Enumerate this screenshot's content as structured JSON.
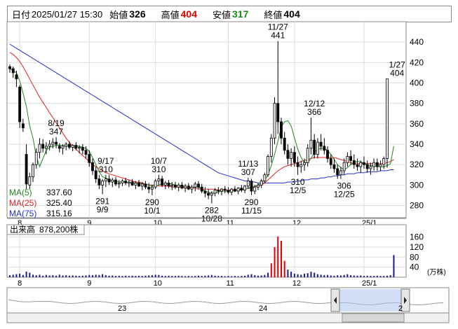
{
  "header": {
    "date_label": "日付",
    "datetime": "2025/01/27 15:30",
    "open_label": "始値",
    "open": "326",
    "high_label": "高値",
    "high": "404",
    "low_label": "安値",
    "low": "317",
    "close_label": "終値",
    "close": "404"
  },
  "colors": {
    "up": "#0a0a0a",
    "down": "#f2f2f2",
    "ma5": "#1a8a1a",
    "ma25": "#e02020",
    "ma75": "#2030d0",
    "vol": "#1a1a8a",
    "vol_hi": "#e00000",
    "high_text": "#e00000",
    "low_text": "#1a8a1a"
  },
  "chart_data": [
    {
      "type": "candlestick",
      "y_axis_ticks": [
        280,
        300,
        320,
        340,
        360,
        380,
        400,
        420,
        440
      ],
      "ylim": [
        268,
        460
      ],
      "x_month_labels": [
        {
          "i": 3,
          "label": "8"
        },
        {
          "i": 24,
          "label": "9"
        },
        {
          "i": 44,
          "label": "10"
        },
        {
          "i": 66,
          "label": "11"
        },
        {
          "i": 86,
          "label": "12"
        },
        {
          "i": 107,
          "label": "25/1"
        }
      ],
      "legend": [
        {
          "name": "MA(5)",
          "value": "337.60",
          "color": "#1a8a1a"
        },
        {
          "name": "MA(25)",
          "value": "325.40",
          "color": "#e02020"
        },
        {
          "name": "MA(75)",
          "value": "315.16",
          "color": "#2030d0"
        }
      ],
      "annotations": [
        {
          "i": 14,
          "y": 347,
          "text": [
            "8/19",
            "347"
          ],
          "pos": "above"
        },
        {
          "i": 29,
          "y": 310,
          "text": [
            "9/17",
            "310"
          ],
          "pos": "above"
        },
        {
          "i": 28,
          "y": 291,
          "text": [
            "291",
            "9/9"
          ],
          "pos": "below"
        },
        {
          "i": 45,
          "y": 310,
          "text": [
            "10/7",
            "310"
          ],
          "pos": "above"
        },
        {
          "i": 43,
          "y": 290,
          "text": [
            "290",
            "10/1"
          ],
          "pos": "below"
        },
        {
          "i": 61,
          "y": 282,
          "text": [
            "282",
            "10/28"
          ],
          "pos": "below"
        },
        {
          "i": 72,
          "y": 307,
          "text": [
            "11/13",
            "307"
          ],
          "pos": "above"
        },
        {
          "i": 73,
          "y": 290,
          "text": [
            "290",
            "11/15",
            ""
          ],
          "pos": "below"
        },
        {
          "i": 81,
          "y": 441,
          "text": [
            "11/27",
            "441"
          ],
          "pos": "above"
        },
        {
          "i": 87,
          "y": 310,
          "text": [
            "310",
            "12/5"
          ],
          "pos": "below"
        },
        {
          "i": 92,
          "y": 366,
          "text": [
            "12/12",
            "366"
          ],
          "pos": "above"
        },
        {
          "i": 101,
          "y": 306,
          "text": [
            "306",
            "12/25"
          ],
          "pos": "below"
        },
        {
          "i": 117,
          "y": 404,
          "text": [
            "1/27",
            "404"
          ],
          "pos": "above"
        }
      ],
      "ohlc": [
        [
          416,
          418,
          410,
          414
        ],
        [
          414,
          416,
          405,
          410
        ],
        [
          408,
          412,
          396,
          404
        ],
        [
          396,
          398,
          356,
          362
        ],
        [
          360,
          365,
          352,
          356
        ],
        [
          330,
          340,
          296,
          301
        ],
        [
          300,
          312,
          296,
          308
        ],
        [
          308,
          322,
          303,
          320
        ],
        [
          320,
          336,
          316,
          332
        ],
        [
          332,
          346,
          326,
          340
        ],
        [
          340,
          345,
          332,
          336
        ],
        [
          336,
          342,
          330,
          338
        ],
        [
          338,
          344,
          334,
          340
        ],
        [
          340,
          346,
          336,
          342
        ],
        [
          342,
          347,
          336,
          340
        ],
        [
          338,
          341,
          332,
          336
        ],
        [
          336,
          340,
          330,
          338
        ],
        [
          338,
          342,
          334,
          340
        ],
        [
          340,
          343,
          335,
          337
        ],
        [
          337,
          340,
          333,
          339
        ],
        [
          339,
          342,
          334,
          336
        ],
        [
          336,
          339,
          331,
          337
        ],
        [
          337,
          340,
          330,
          334
        ],
        [
          334,
          338,
          326,
          330
        ],
        [
          330,
          334,
          318,
          322
        ],
        [
          322,
          326,
          310,
          314
        ],
        [
          314,
          318,
          302,
          306
        ],
        [
          306,
          310,
          296,
          300
        ],
        [
          300,
          306,
          291,
          304
        ],
        [
          304,
          310,
          298,
          306
        ],
        [
          306,
          310,
          300,
          303
        ],
        [
          303,
          307,
          298,
          305
        ],
        [
          305,
          308,
          299,
          301
        ],
        [
          301,
          305,
          297,
          302
        ],
        [
          302,
          306,
          299,
          304
        ],
        [
          304,
          307,
          300,
          302
        ],
        [
          302,
          305,
          298,
          303
        ],
        [
          303,
          306,
          299,
          300
        ],
        [
          300,
          304,
          296,
          302
        ],
        [
          302,
          305,
          298,
          299
        ],
        [
          299,
          303,
          295,
          301
        ],
        [
          301,
          304,
          296,
          298
        ],
        [
          298,
          302,
          292,
          296
        ],
        [
          296,
          300,
          290,
          298
        ],
        [
          298,
          306,
          296,
          304
        ],
        [
          304,
          310,
          300,
          306
        ],
        [
          306,
          309,
          298,
          300
        ],
        [
          300,
          304,
          296,
          302
        ],
        [
          302,
          305,
          297,
          299
        ],
        [
          299,
          303,
          295,
          300
        ],
        [
          300,
          303,
          296,
          298
        ],
        [
          298,
          302,
          294,
          300
        ],
        [
          300,
          303,
          296,
          297
        ],
        [
          297,
          301,
          293,
          299
        ],
        [
          299,
          302,
          295,
          296
        ],
        [
          296,
          300,
          292,
          298
        ],
        [
          298,
          303,
          294,
          301
        ],
        [
          301,
          304,
          296,
          298
        ],
        [
          298,
          301,
          292,
          294
        ],
        [
          294,
          298,
          288,
          292
        ],
        [
          292,
          296,
          286,
          290
        ],
        [
          290,
          294,
          282,
          292
        ],
        [
          292,
          297,
          289,
          295
        ],
        [
          295,
          298,
          291,
          294
        ],
        [
          294,
          297,
          290,
          296
        ],
        [
          296,
          299,
          292,
          295
        ],
        [
          295,
          298,
          291,
          293
        ],
        [
          293,
          297,
          290,
          296
        ],
        [
          296,
          299,
          293,
          294
        ],
        [
          294,
          298,
          291,
          297
        ],
        [
          297,
          300,
          293,
          295
        ],
        [
          295,
          300,
          292,
          299
        ],
        [
          299,
          307,
          296,
          304
        ],
        [
          304,
          306,
          290,
          294
        ],
        [
          294,
          300,
          291,
          298
        ],
        [
          298,
          302,
          295,
          300
        ],
        [
          300,
          306,
          297,
          304
        ],
        [
          304,
          312,
          302,
          310
        ],
        [
          310,
          330,
          308,
          328
        ],
        [
          328,
          350,
          322,
          346
        ],
        [
          346,
          386,
          340,
          380
        ],
        [
          380,
          441,
          350,
          362
        ],
        [
          362,
          366,
          340,
          346
        ],
        [
          346,
          352,
          330,
          334
        ],
        [
          334,
          340,
          320,
          326
        ],
        [
          326,
          336,
          318,
          332
        ],
        [
          332,
          338,
          318,
          322
        ],
        [
          322,
          328,
          310,
          318
        ],
        [
          318,
          324,
          312,
          320
        ],
        [
          320,
          326,
          314,
          322
        ],
        [
          322,
          340,
          318,
          336
        ],
        [
          336,
          366,
          330,
          344
        ],
        [
          344,
          350,
          326,
          330
        ],
        [
          330,
          346,
          326,
          342
        ],
        [
          342,
          350,
          334,
          338
        ],
        [
          338,
          346,
          330,
          334
        ],
        [
          334,
          338,
          322,
          326
        ],
        [
          326,
          330,
          316,
          320
        ],
        [
          320,
          326,
          312,
          316
        ],
        [
          316,
          320,
          306,
          310
        ],
        [
          310,
          318,
          306,
          314
        ],
        [
          314,
          326,
          310,
          322
        ],
        [
          322,
          332,
          318,
          328
        ],
        [
          328,
          334,
          320,
          324
        ],
        [
          324,
          330,
          316,
          320
        ],
        [
          320,
          326,
          314,
          318
        ],
        [
          318,
          324,
          312,
          322
        ],
        [
          322,
          328,
          316,
          320
        ],
        [
          320,
          324,
          312,
          316
        ],
        [
          316,
          322,
          310,
          318
        ],
        [
          318,
          326,
          314,
          322
        ],
        [
          322,
          326,
          314,
          318
        ],
        [
          318,
          324,
          314,
          320
        ],
        [
          320,
          328,
          316,
          326
        ],
        [
          326,
          404,
          317,
          404
        ]
      ],
      "ma5": [
        414,
        412,
        410,
        402,
        390,
        377,
        358,
        346,
        328,
        318,
        326,
        334,
        337,
        338,
        339,
        339,
        339,
        338,
        338,
        338,
        338,
        338,
        337,
        336,
        333,
        327,
        320,
        313,
        308,
        307,
        305,
        304,
        304,
        303,
        303,
        303,
        302,
        302,
        302,
        302,
        301,
        301,
        300,
        299,
        299,
        300,
        301,
        301,
        302,
        301,
        300,
        299,
        299,
        298,
        298,
        298,
        298,
        298,
        296,
        294,
        293,
        292,
        292,
        293,
        294,
        294,
        294,
        294,
        295,
        295,
        295,
        296,
        297,
        298,
        299,
        300,
        302,
        305,
        310,
        319,
        330,
        343,
        357,
        362,
        363,
        358,
        346,
        335,
        327,
        322,
        322,
        326,
        332,
        335,
        336,
        336,
        334,
        330,
        325,
        320,
        317,
        315,
        317,
        320,
        322,
        323,
        323,
        321,
        320,
        319,
        319,
        318,
        318,
        318,
        319,
        321,
        338
      ],
      "ma25": [
        430,
        428,
        425,
        421,
        416,
        410,
        404,
        398,
        392,
        386,
        381,
        376,
        371,
        366,
        361,
        356,
        351,
        346,
        342,
        338,
        335,
        332,
        329,
        326,
        323,
        320,
        318,
        316,
        314,
        312,
        311,
        310,
        309,
        308,
        307,
        306,
        305,
        304,
        303,
        303,
        302,
        301,
        300,
        300,
        300,
        299,
        299,
        299,
        299,
        298,
        298,
        298,
        298,
        297,
        297,
        297,
        297,
        296,
        296,
        296,
        296,
        296,
        296,
        295,
        295,
        295,
        295,
        295,
        295,
        295,
        296,
        296,
        297,
        297,
        298,
        299,
        300,
        302,
        305,
        308,
        311,
        314,
        316,
        318,
        319,
        320,
        321,
        322,
        323,
        324,
        325,
        326,
        327,
        327,
        327,
        327,
        327,
        327,
        327,
        326,
        325,
        324,
        323,
        322,
        321,
        321,
        321,
        321,
        321,
        321,
        321,
        321,
        321,
        321,
        322,
        323,
        325
      ],
      "ma75": [
        438,
        436,
        434,
        432,
        430,
        428,
        426,
        424,
        422,
        420,
        418,
        416,
        414,
        412,
        410,
        408,
        406,
        404,
        402,
        400,
        398,
        396,
        394,
        392,
        390,
        388,
        386,
        384,
        382,
        380,
        378,
        376,
        374,
        372,
        370,
        368,
        366,
        364,
        362,
        360,
        358,
        356,
        354,
        352,
        350,
        348,
        346,
        344,
        342,
        340,
        338,
        336,
        334,
        332,
        330,
        328,
        326,
        324,
        322,
        320,
        318,
        316,
        314,
        312,
        311,
        310,
        309,
        308,
        307,
        306,
        305,
        304,
        304,
        303,
        303,
        302,
        302,
        302,
        302,
        302,
        302,
        302,
        302,
        302,
        303,
        303,
        303,
        304,
        304,
        305,
        305,
        306,
        306,
        306,
        307,
        307,
        308,
        308,
        309,
        309,
        310,
        310,
        311,
        311,
        311,
        312,
        312,
        312,
        313,
        313,
        313,
        313,
        314,
        314,
        314,
        315,
        315
      ]
    },
    {
      "type": "bar",
      "title": "出来高",
      "value_text": "878,200株",
      "unit": "(万株)",
      "y_axis_ticks": [
        40,
        80,
        120,
        160
      ],
      "ylim": [
        0,
        170
      ],
      "values": [
        8,
        10,
        12,
        14,
        9,
        22,
        18,
        10,
        8,
        10,
        6,
        9,
        7,
        8,
        6,
        10,
        7,
        8,
        6,
        7,
        6,
        5,
        6,
        7,
        9,
        8,
        10,
        9,
        12,
        8,
        6,
        7,
        5,
        6,
        5,
        6,
        5,
        6,
        5,
        6,
        5,
        6,
        7,
        8,
        10,
        9,
        6,
        5,
        6,
        5,
        5,
        6,
        5,
        4,
        5,
        4,
        5,
        6,
        5,
        6,
        7,
        9,
        6,
        5,
        5,
        4,
        5,
        4,
        5,
        4,
        5,
        6,
        10,
        12,
        8,
        6,
        7,
        9,
        18,
        55,
        120,
        162,
        145,
        65,
        30,
        22,
        14,
        12,
        10,
        14,
        16,
        22,
        18,
        12,
        10,
        8,
        9,
        7,
        6,
        8,
        7,
        9,
        12,
        8,
        7,
        6,
        7,
        5,
        6,
        5,
        5,
        6,
        5,
        5,
        6,
        8,
        88
      ],
      "highlight": [
        79,
        80,
        81,
        82,
        83,
        117
      ]
    }
  ],
  "nav": {
    "labels": [
      {
        "text": "23",
        "x": 168
      },
      {
        "text": "24",
        "x": 369
      },
      {
        "text": "2",
        "x": 568
      }
    ]
  }
}
